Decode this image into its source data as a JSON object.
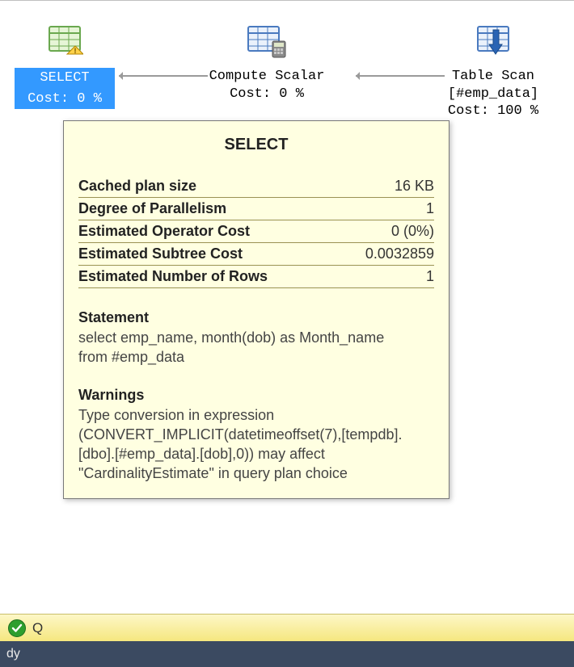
{
  "plan": {
    "select": {
      "label": "SELECT",
      "cost_line": "Cost: 0 %"
    },
    "compute": {
      "label": "Compute Scalar",
      "cost_line": "Cost: 0 %"
    },
    "scan": {
      "label": "Table Scan",
      "object_line": "[#emp_data]",
      "cost_line": "Cost: 100 %"
    }
  },
  "tooltip": {
    "title": "SELECT",
    "rows": [
      {
        "k": "Cached plan size",
        "v": "16 KB"
      },
      {
        "k": "Degree of Parallelism",
        "v": "1"
      },
      {
        "k": "Estimated Operator Cost",
        "v": "0 (0%)"
      },
      {
        "k": "Estimated Subtree Cost",
        "v": "0.0032859"
      },
      {
        "k": "Estimated Number of Rows",
        "v": "1"
      }
    ],
    "statement_head": "Statement",
    "statement_body": "select emp_name, month(dob) as Month_name\nfrom #emp_data",
    "warnings_head": "Warnings",
    "warnings_body": "Type conversion in expression (CONVERT_IMPLICIT(datetimeoffset(7),[tempdb].[dbo].[#emp_data].[dob],0)) may affect \"CardinalityEstimate\" in query plan choice"
  },
  "status": {
    "text": "Q"
  },
  "footer": {
    "text": "dy"
  }
}
